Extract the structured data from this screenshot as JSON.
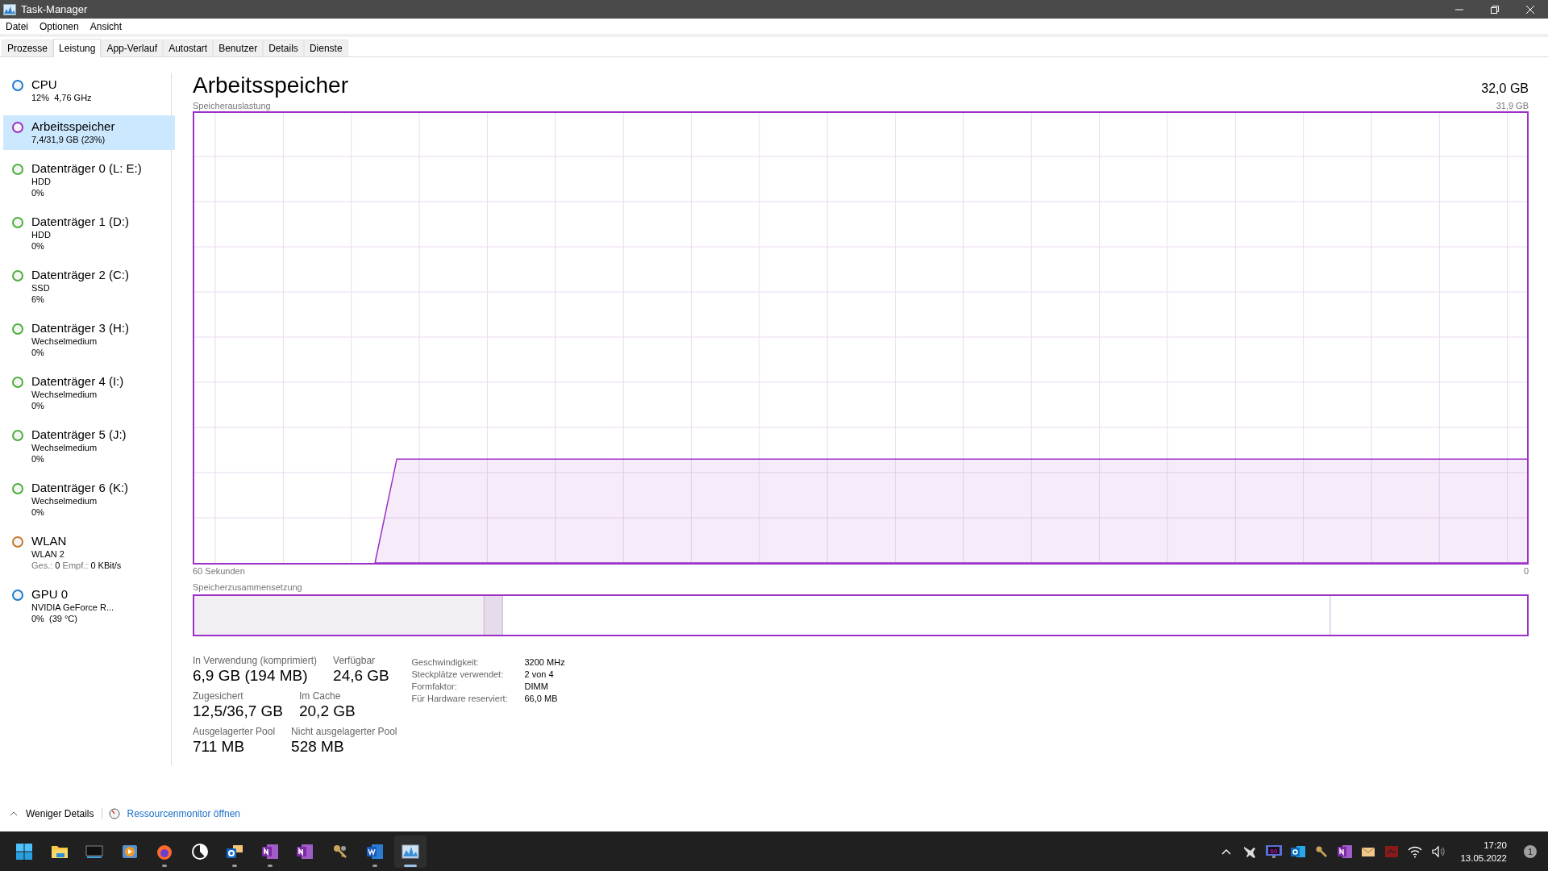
{
  "window": {
    "title": "Task-Manager"
  },
  "menu": [
    "Datei",
    "Optionen",
    "Ansicht"
  ],
  "tabs": [
    {
      "label": "Prozesse",
      "selected": false
    },
    {
      "label": "Leistung",
      "selected": true
    },
    {
      "label": "App-Verlauf",
      "selected": false
    },
    {
      "label": "Autostart",
      "selected": false
    },
    {
      "label": "Benutzer",
      "selected": false
    },
    {
      "label": "Details",
      "selected": false
    },
    {
      "label": "Dienste",
      "selected": false
    }
  ],
  "sidebar": {
    "items": [
      {
        "name": "CPU",
        "lines": [
          "12%  4,76 GHz"
        ],
        "color": "#1c7ad4",
        "selected": false
      },
      {
        "name": "Arbeitsspeicher",
        "lines": [
          "7,4/31,9 GB (23%)"
        ],
        "color": "#9b30c8",
        "selected": true
      },
      {
        "name": "Datenträger 0 (L: E:)",
        "lines": [
          "HDD",
          "0%"
        ],
        "color": "#4caf3a",
        "selected": false
      },
      {
        "name": "Datenträger 1 (D:)",
        "lines": [
          "HDD",
          "0%"
        ],
        "color": "#4caf3a",
        "selected": false
      },
      {
        "name": "Datenträger 2 (C:)",
        "lines": [
          "SSD",
          "6%"
        ],
        "color": "#4caf3a",
        "selected": false
      },
      {
        "name": "Datenträger 3 (H:)",
        "lines": [
          "Wechselmedium",
          "0%"
        ],
        "color": "#4caf3a",
        "selected": false
      },
      {
        "name": "Datenträger 4 (I:)",
        "lines": [
          "Wechselmedium",
          "0%"
        ],
        "color": "#4caf3a",
        "selected": false
      },
      {
        "name": "Datenträger 5 (J:)",
        "lines": [
          "Wechselmedium",
          "0%"
        ],
        "color": "#4caf3a",
        "selected": false
      },
      {
        "name": "Datenträger 6 (K:)",
        "lines": [
          "Wechselmedium",
          "0%"
        ],
        "color": "#4caf3a",
        "selected": false
      },
      {
        "name": "WLAN",
        "lines": [
          "WLAN 2"
        ],
        "rate": [
          {
            "label": "Ges.:",
            "value": "0"
          },
          {
            "label": "Empf.:",
            "value": "0 KBit/s"
          }
        ],
        "color": "#c8782a",
        "selected": false
      },
      {
        "name": "GPU 0",
        "lines": [
          "NVIDIA GeForce R...",
          "0%  (39 °C)"
        ],
        "color": "#1c7ad4",
        "selected": false
      }
    ]
  },
  "main": {
    "title": "Arbeitsspeicher",
    "total": "32,0 GB",
    "usage_label": "Speicherauslastung",
    "usage_max": "31,9 GB",
    "time_span": "60 Sekunden",
    "time_end": "0",
    "composition_label": "Speicherzusammensetzung",
    "stats": [
      [
        {
          "label": "In Verwendung (komprimiert)",
          "value": "6,9 GB (194 MB)"
        },
        {
          "label": "Verfügbar",
          "value": "24,6 GB"
        }
      ],
      [
        {
          "label": "Zugesichert",
          "value": "12,5/36,7 GB"
        },
        {
          "label": "Im Cache",
          "value": "20,2 GB"
        }
      ],
      [
        {
          "label": "Ausgelagerter Pool",
          "value": "711 MB"
        },
        {
          "label": "Nicht ausgelagerter Pool",
          "value": "528 MB"
        }
      ]
    ],
    "specs": [
      {
        "label": "Geschwindigkeit:",
        "value": "3200 MHz"
      },
      {
        "label": "Steckplätze verwendet:",
        "value": "2 von 4"
      },
      {
        "label": "Formfaktor:",
        "value": "DIMM"
      },
      {
        "label": "Für Hardware reserviert:",
        "value": "66,0 MB"
      }
    ]
  },
  "footer": {
    "less_details": "Weniger Details",
    "resource_monitor": "Ressourcenmonitor öffnen"
  },
  "taskbar": {
    "apps": [
      {
        "kind": "start",
        "running": false,
        "selected": false
      },
      {
        "kind": "folder",
        "running": false,
        "selected": false
      },
      {
        "kind": "terminal",
        "running": false,
        "selected": false
      },
      {
        "kind": "media",
        "running": false,
        "selected": false
      },
      {
        "kind": "browser",
        "running": true,
        "selected": false
      },
      {
        "kind": "pie",
        "running": false,
        "selected": false
      },
      {
        "kind": "mail",
        "running": true,
        "selected": false
      },
      {
        "kind": "notes",
        "running": true,
        "selected": false
      },
      {
        "kind": "notes",
        "running": false,
        "selected": false
      },
      {
        "kind": "keys",
        "running": false,
        "selected": false
      },
      {
        "kind": "word",
        "running": true,
        "selected": false
      },
      {
        "kind": "monitor",
        "running": true,
        "selected": true
      }
    ],
    "monitor_badge": "60",
    "time": "17:20",
    "date": "13.05.2022",
    "notifications": "1"
  }
}
